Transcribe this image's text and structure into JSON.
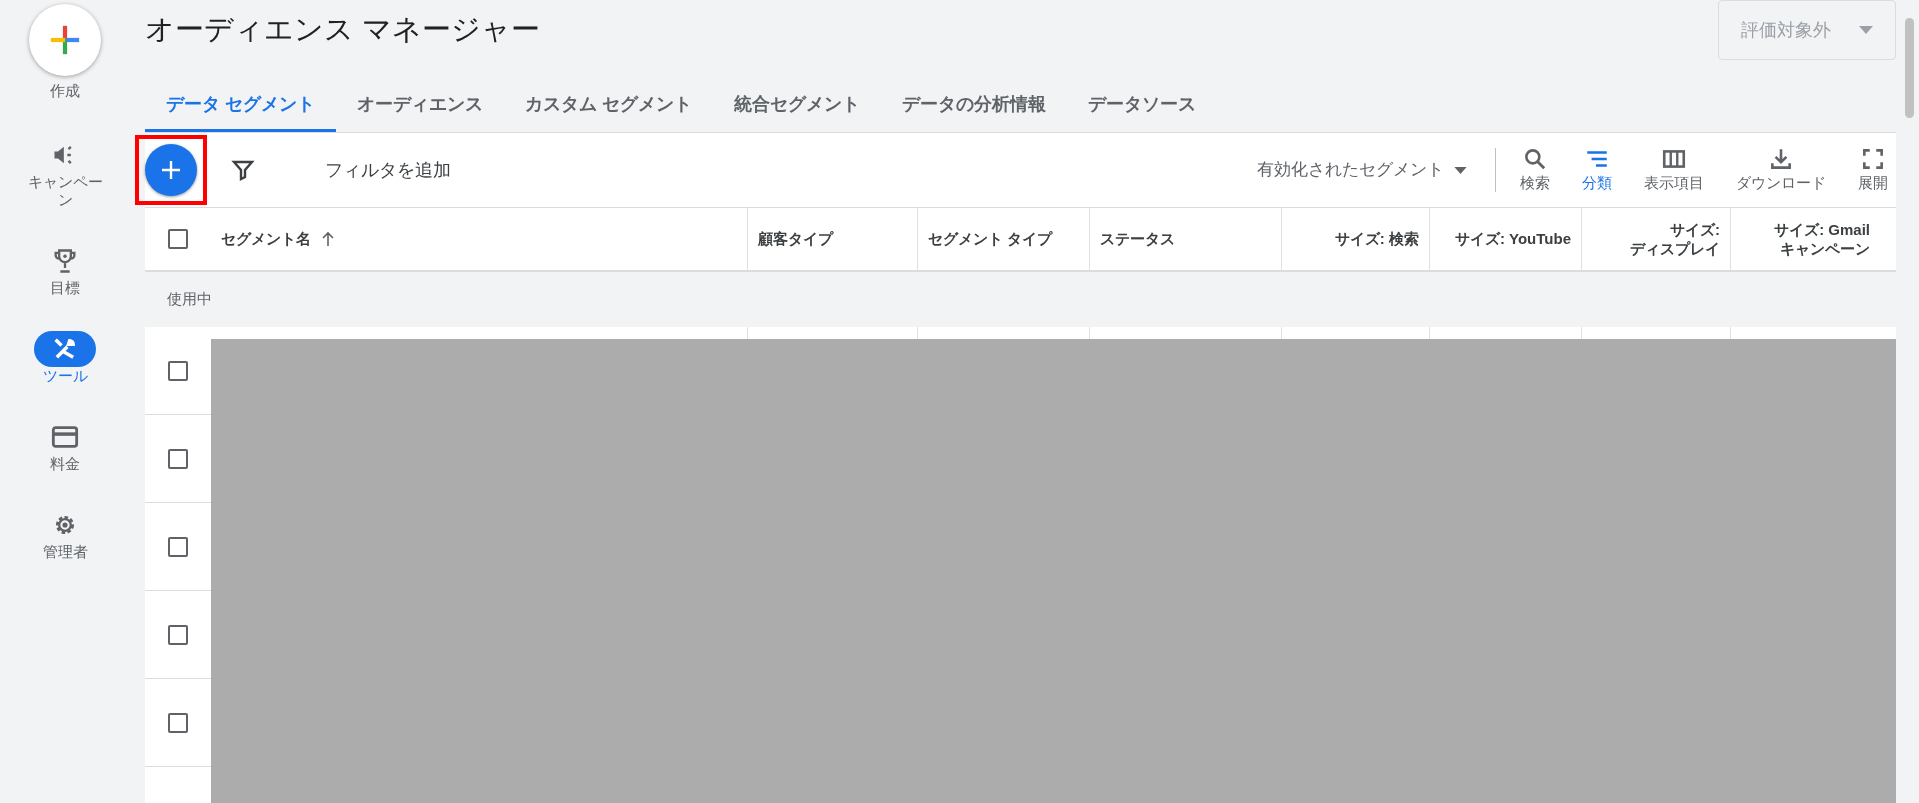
{
  "sidebar": {
    "create_label": "作成",
    "items": [
      {
        "label": "キャンペーン",
        "selected": false
      },
      {
        "label": "目標",
        "selected": false
      },
      {
        "label": "ツール",
        "selected": true
      },
      {
        "label": "料金",
        "selected": false
      },
      {
        "label": "管理者",
        "selected": false
      }
    ]
  },
  "page_title": "オーディエンス マネージャー",
  "account_dropdown": {
    "value": "評価対象外",
    "disabled": true
  },
  "tabs": [
    {
      "label": "データ セグメント",
      "selected": true
    },
    {
      "label": "オーディエンス",
      "selected": false
    },
    {
      "label": "カスタム セグメント",
      "selected": false
    },
    {
      "label": "統合セグメント",
      "selected": false
    },
    {
      "label": "データの分析情報",
      "selected": false
    },
    {
      "label": "データソース",
      "selected": false
    }
  ],
  "toolbar": {
    "add_highlighted": true,
    "filter_label": "フィルタを追加",
    "segment_filter": "有効化されたセグメント",
    "actions": [
      {
        "label": "検索",
        "selected": false
      },
      {
        "label": "分類",
        "selected": true
      },
      {
        "label": "表示項目",
        "selected": false
      },
      {
        "label": "ダウンロード",
        "selected": false
      },
      {
        "label": "展開",
        "selected": false
      }
    ]
  },
  "table": {
    "select_all_checked": false,
    "columns": [
      {
        "label": "セグメント名",
        "sorted": true
      },
      {
        "label": "顧客タイプ",
        "sorted": false
      },
      {
        "label": "セグメント タイプ",
        "sorted": false
      },
      {
        "label": "ステータス",
        "sorted": false
      },
      {
        "label": "サイズ: 検索",
        "sorted": false
      },
      {
        "label": "サイズ: YouTube",
        "sorted": false
      },
      {
        "label": "サイズ: ディスプレイ",
        "sorted": false
      },
      {
        "label": "サイズ: Gmail キャンペーン",
        "sorted": false
      }
    ],
    "group_label": "使用中",
    "rows": [
      {
        "checked": false
      },
      {
        "checked": false
      },
      {
        "checked": false
      },
      {
        "checked": false
      },
      {
        "checked": false
      }
    ]
  }
}
